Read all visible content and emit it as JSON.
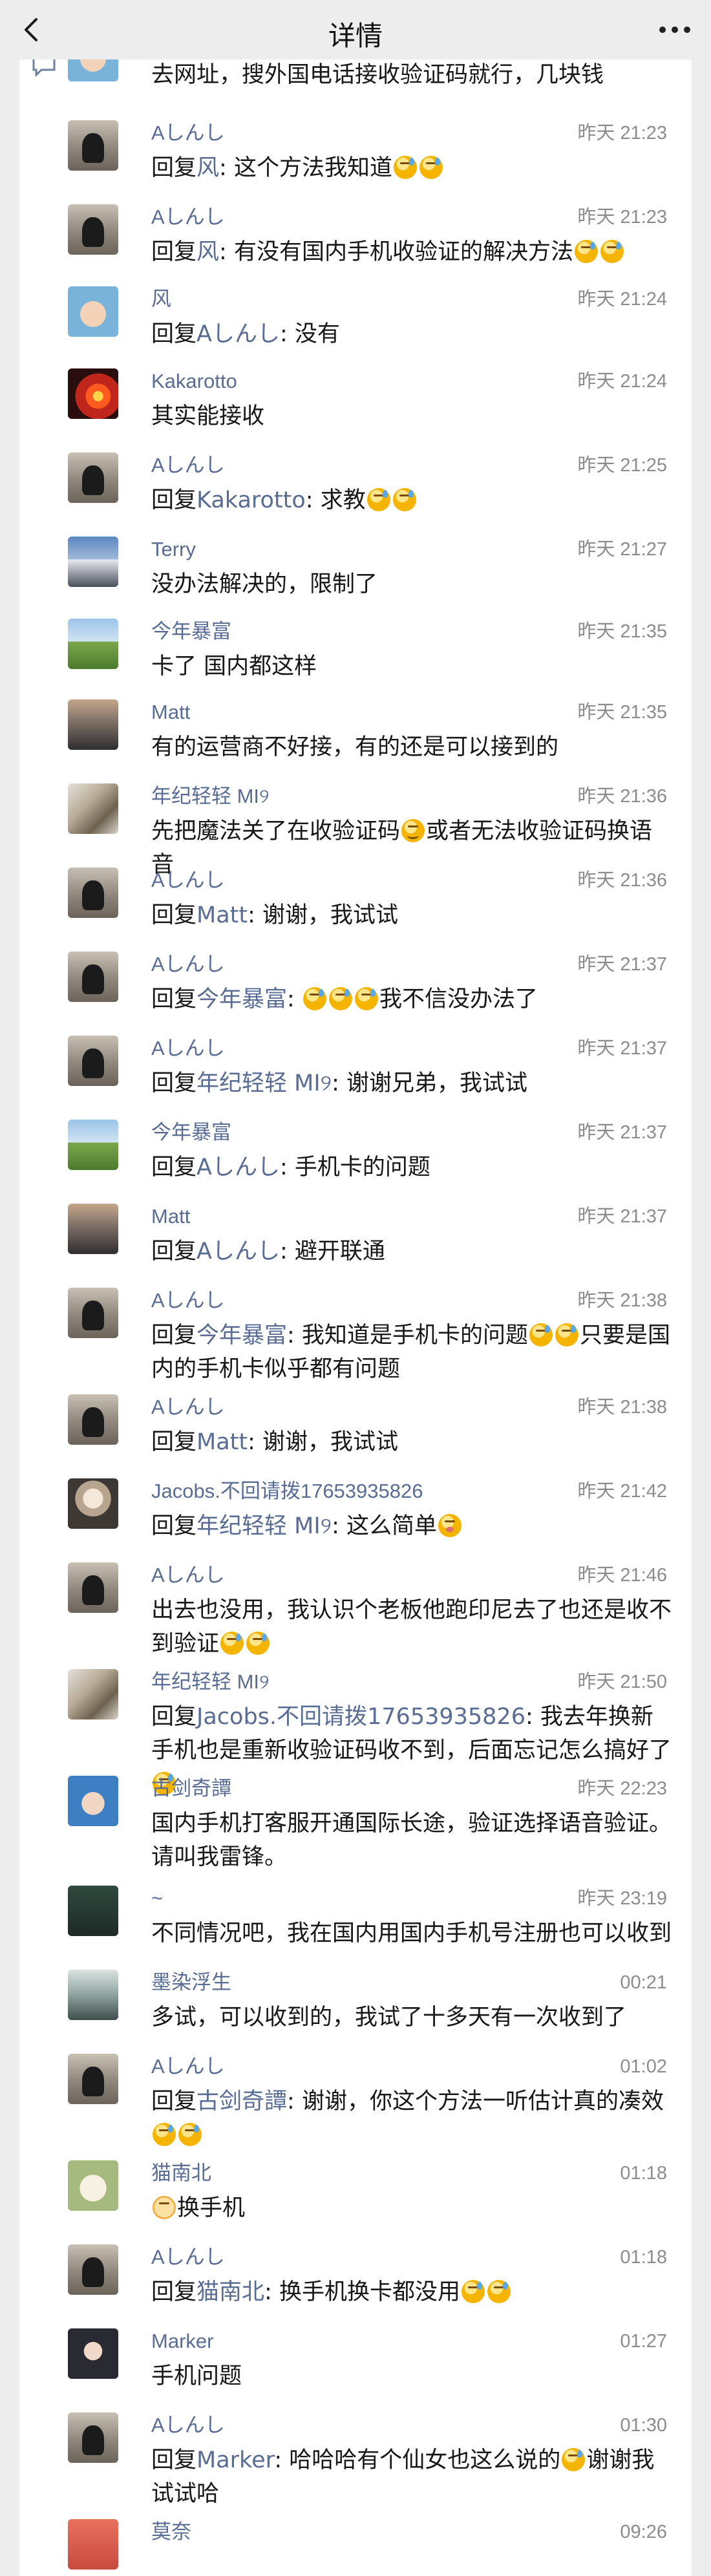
{
  "navbar": {
    "title": "详情",
    "back_icon": "chevron-left-icon",
    "more_icon": "more-dots-icon"
  },
  "top_partial": {
    "text": "去网址，搜外国电话接收验证码就行，几块钱"
  },
  "comments": [
    {
      "name": "Aしんし",
      "time": "昨天 21:23",
      "avatar": "cat-avatar",
      "reply_prefix": "回复",
      "reply_to": "风",
      "body": ": 这个方法我知道",
      "emoji_tail": [
        "sweat-smile",
        "sweat-smile"
      ]
    },
    {
      "name": "Aしんし",
      "time": "昨天 21:23",
      "avatar": "cat-avatar",
      "reply_prefix": "回复",
      "reply_to": "风",
      "body": ": 有没有国内手机收验证的解决方法",
      "emoji_tail": [
        "sweat-smile",
        "sweat-smile"
      ]
    },
    {
      "name": "风",
      "time": "昨天 21:24",
      "avatar": "baby-avatar",
      "reply_prefix": "回复",
      "reply_to": "Aしんし",
      "body": ": 没有",
      "emoji_tail": []
    },
    {
      "name": "Kakarotto",
      "time": "昨天 21:24",
      "avatar": "fire-avatar",
      "reply_prefix": "",
      "reply_to": "",
      "body": "其实能接收",
      "emoji_tail": []
    },
    {
      "name": "Aしんし",
      "time": "昨天 21:25",
      "avatar": "cat-avatar",
      "reply_prefix": "回复",
      "reply_to": "Kakarotto",
      "body": ": 求教",
      "emoji_tail": [
        "sweat-smile",
        "sweat-smile"
      ]
    },
    {
      "name": "Terry",
      "time": "昨天 21:27",
      "avatar": "sky-avatar",
      "reply_prefix": "",
      "reply_to": "",
      "body": "没办法解决的，限制了",
      "emoji_tail": []
    },
    {
      "name": "今年暴富",
      "time": "昨天 21:35",
      "avatar": "grass-avatar",
      "reply_prefix": "",
      "reply_to": "",
      "body": "卡了 国内都这样",
      "emoji_tail": []
    },
    {
      "name": "Matt",
      "time": "昨天 21:35",
      "avatar": "dusk-avatar",
      "reply_prefix": "",
      "reply_to": "",
      "body": "有的运营商不好接，有的还是可以接到的",
      "emoji_tail": []
    },
    {
      "name": "年纪轻轻 MI୨",
      "time": "昨天 21:36",
      "avatar": "tree-avatar",
      "reply_prefix": "",
      "reply_to": "",
      "body": "先把魔法关了在收验证码",
      "mid_emoji": "smirk",
      "body_after": "或者无法收验证码换语音",
      "emoji_tail": []
    },
    {
      "name": "Aしんし",
      "time": "昨天 21:36",
      "avatar": "cat-avatar",
      "reply_prefix": "回复",
      "reply_to": "Matt",
      "body": ": 谢谢，我试试",
      "emoji_tail": []
    },
    {
      "name": "Aしんし",
      "time": "昨天 21:37",
      "avatar": "cat-avatar",
      "reply_prefix": "回复",
      "reply_to": "今年暴富",
      "body": ": ",
      "emoji_lead": [
        "sweat-smile",
        "sweat-smile",
        "sweat-smile"
      ],
      "body_after": "我不信没办法了",
      "emoji_tail": []
    },
    {
      "name": "Aしんし",
      "time": "昨天 21:37",
      "avatar": "cat-avatar",
      "reply_prefix": "回复",
      "reply_to": "年纪轻轻 MI୨",
      "body": ": 谢谢兄弟，我试试",
      "emoji_tail": []
    },
    {
      "name": "今年暴富",
      "time": "昨天 21:37",
      "avatar": "grass-avatar",
      "reply_prefix": "回复",
      "reply_to": "Aしんし",
      "body": ": 手机卡的问题",
      "emoji_tail": []
    },
    {
      "name": "Matt",
      "time": "昨天 21:37",
      "avatar": "dusk-avatar",
      "reply_prefix": "回复",
      "reply_to": "Aしんし",
      "body": ": 避开联通",
      "emoji_tail": []
    },
    {
      "name": "Aしんし",
      "time": "昨天 21:38",
      "avatar": "cat-avatar",
      "reply_prefix": "回复",
      "reply_to": "今年暴富",
      "body": ": 我知道是手机卡的问题",
      "mid_emojis": [
        "sweat-smile",
        "sweat-smile"
      ],
      "body_after": "只要是国内的手机卡似乎都有问题",
      "emoji_tail": []
    },
    {
      "name": "Aしんし",
      "time": "昨天 21:38",
      "avatar": "cat-avatar",
      "reply_prefix": "回复",
      "reply_to": "Matt",
      "body": ": 谢谢，我试试",
      "emoji_tail": []
    },
    {
      "name": "Jacobs.不回请拨17653935826",
      "time": "昨天 21:42",
      "avatar": "figure-avatar",
      "reply_prefix": "回复",
      "reply_to": "年纪轻轻 MI୨",
      "body": ": 这么简单",
      "emoji_tail": [
        "flushed"
      ]
    },
    {
      "name": "Aしんし",
      "time": "昨天 21:46",
      "avatar": "cat-avatar",
      "reply_prefix": "",
      "reply_to": "",
      "body": "出去也没用，我认识个老板他跑印尼去了也还是收不到验证",
      "emoji_tail": [
        "sweat-smile",
        "sweat-smile"
      ]
    },
    {
      "name": "年纪轻轻 MI୨",
      "time": "昨天 21:50",
      "avatar": "tree-avatar",
      "reply_prefix": "回复",
      "reply_to": "Jacobs.不回请拨17653935826",
      "body": ": 我去年换新手机也是重新收验证码收不到，后面忘记怎么搞好了",
      "emoji_tail": [
        "sweat-smile"
      ]
    },
    {
      "name": "古剑奇譚",
      "time": "昨天 22:23",
      "avatar": "blue-avatar",
      "reply_prefix": "",
      "reply_to": "",
      "body": "国内手机打客服开通国际长途，验证选择语音验证。请叫我雷锋。",
      "emoji_tail": []
    },
    {
      "name": "~",
      "time": "昨天 23:19",
      "avatar": "dark-avatar",
      "reply_prefix": "",
      "reply_to": "",
      "body": "不同情况吧，我在国内用国内手机号注册也可以收到",
      "emoji_tail": []
    },
    {
      "name": "墨染浮生",
      "time": "00:21",
      "avatar": "ink-avatar",
      "reply_prefix": "",
      "reply_to": "",
      "body": "多试，可以收到的，我试了十多天有一次收到了",
      "emoji_tail": []
    },
    {
      "name": "Aしんし",
      "time": "01:02",
      "avatar": "cat-avatar",
      "reply_prefix": "回复",
      "reply_to": "古剑奇譚",
      "body": ": 谢谢，你这个方法一听估计真的凑效",
      "emoji_tail": [
        "sweat-smile",
        "sweat-smile"
      ]
    },
    {
      "name": "猫南北",
      "time": "01:18",
      "avatar": "catcute-avatar",
      "reply_prefix": "",
      "reply_to": "",
      "body": "换手机",
      "emoji_lead_plain": [
        "cat-face"
      ],
      "emoji_tail": []
    },
    {
      "name": "Aしんし",
      "time": "01:18",
      "avatar": "cat-avatar",
      "reply_prefix": "回复",
      "reply_to": "猫南北",
      "body": ": 换手机换卡都没用",
      "emoji_tail": [
        "sweat-smile",
        "sweat-smile"
      ]
    },
    {
      "name": "Marker",
      "time": "01:27",
      "avatar": "girl-avatar",
      "reply_prefix": "",
      "reply_to": "",
      "body": "手机问题",
      "emoji_tail": []
    },
    {
      "name": "Aしんし",
      "time": "01:30",
      "avatar": "cat-avatar",
      "reply_prefix": "回复",
      "reply_to": "Marker",
      "body": ": 哈哈哈有个仙女也这么说的",
      "mid_emoji": "grin-sweat",
      "body_after": "谢谢我试试哈",
      "emoji_tail": []
    },
    {
      "name": "莫奈",
      "time": "09:26",
      "avatar": "red-avatar",
      "reply_prefix": "",
      "reply_to": "",
      "body": "",
      "emoji_tail": []
    }
  ]
}
